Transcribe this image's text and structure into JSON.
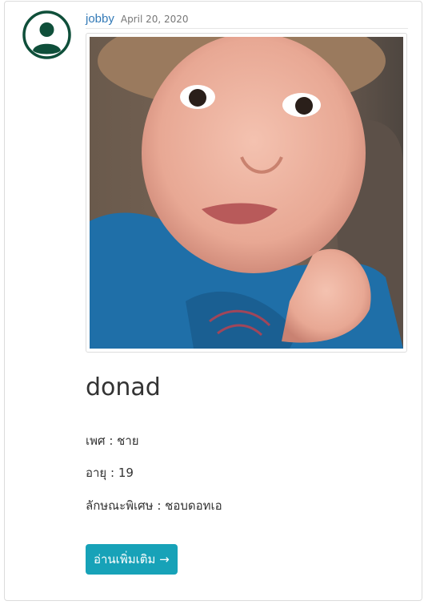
{
  "post": {
    "author": "jobby",
    "date": "April 20, 2020",
    "title": "donad",
    "fields": [
      {
        "label": "เพศ",
        "value": "ชาย"
      },
      {
        "label": "อายุ",
        "value": "19"
      },
      {
        "label": "ลักษณะพิเศษ",
        "value": "ชอบดอทเอ"
      }
    ],
    "read_more": "อ่านเพิ่มเติม →"
  },
  "icons": {
    "avatar": "user-circle-icon"
  },
  "colors": {
    "avatar": "#0f5132",
    "author_link": "#337ab7",
    "button": "#17a2b8"
  }
}
